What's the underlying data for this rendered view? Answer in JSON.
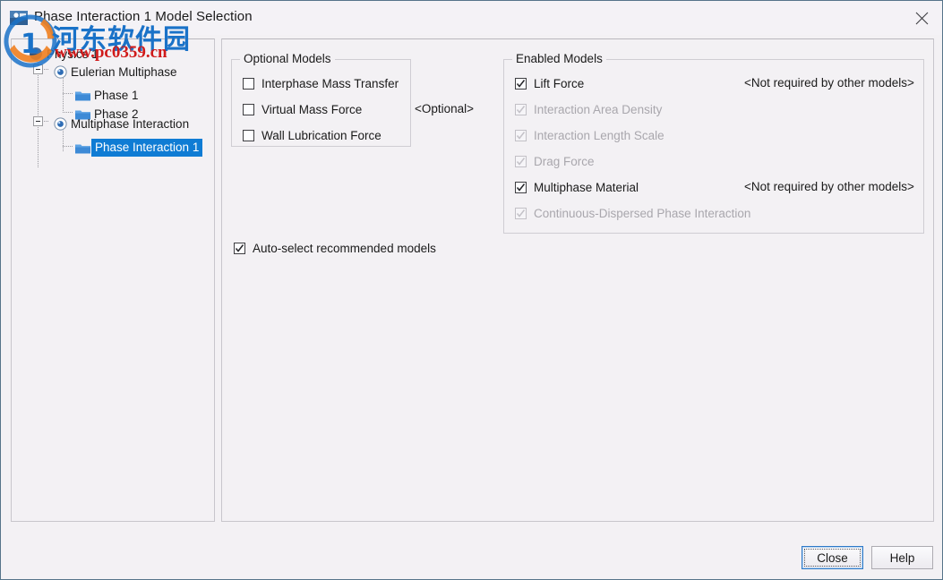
{
  "window": {
    "title": "Phase Interaction 1 Model Selection",
    "icon": "app-icon",
    "close_icon": "close-icon"
  },
  "tree": {
    "nodes": [
      {
        "label": "Physics 1",
        "icon": "physics-icon",
        "depth": 0,
        "selected": false,
        "expander": null
      },
      {
        "label": "Eulerian Multiphase",
        "icon": "model-icon",
        "depth": 1,
        "selected": false,
        "expander": "collapse"
      },
      {
        "label": "Phase 1",
        "icon": "folder-icon",
        "depth": 2,
        "selected": false,
        "expander": null
      },
      {
        "label": "Phase 2",
        "icon": "folder-icon",
        "depth": 2,
        "selected": false,
        "expander": null
      },
      {
        "label": "Multiphase Interaction",
        "icon": "model-icon",
        "depth": 1,
        "selected": false,
        "expander": "collapse"
      },
      {
        "label": "Phase Interaction 1",
        "icon": "folder-icon",
        "depth": 2,
        "selected": true,
        "expander": null
      }
    ],
    "selection_color": "#0f7cd4"
  },
  "optional_models": {
    "title": "Optional Models",
    "side_note": "<Optional>",
    "items": [
      {
        "label": "Interphase Mass Transfer",
        "checked": false,
        "enabled": true
      },
      {
        "label": "Virtual Mass Force",
        "checked": false,
        "enabled": true
      },
      {
        "label": "Wall Lubrication Force",
        "checked": false,
        "enabled": true
      }
    ]
  },
  "enabled_models": {
    "title": "Enabled Models",
    "items": [
      {
        "label": "Lift Force",
        "checked": true,
        "enabled": true,
        "note": "<Not required by other models>"
      },
      {
        "label": "Interaction Area Density",
        "checked": true,
        "enabled": false,
        "note": ""
      },
      {
        "label": "Interaction Length Scale",
        "checked": true,
        "enabled": false,
        "note": ""
      },
      {
        "label": "Drag Force",
        "checked": true,
        "enabled": false,
        "note": ""
      },
      {
        "label": "Multiphase Material",
        "checked": true,
        "enabled": true,
        "note": "<Not required by other models>"
      },
      {
        "label": "Continuous-Dispersed Phase Interaction",
        "checked": true,
        "enabled": false,
        "note": ""
      }
    ]
  },
  "auto_select": {
    "label": "Auto-select recommended models",
    "checked": true
  },
  "buttons": {
    "close": "Close",
    "help": "Help"
  },
  "watermark": {
    "chinese": "河东软件园",
    "url": "www.pc0359.cn",
    "logo_icon": "watermark-logo-icon"
  }
}
